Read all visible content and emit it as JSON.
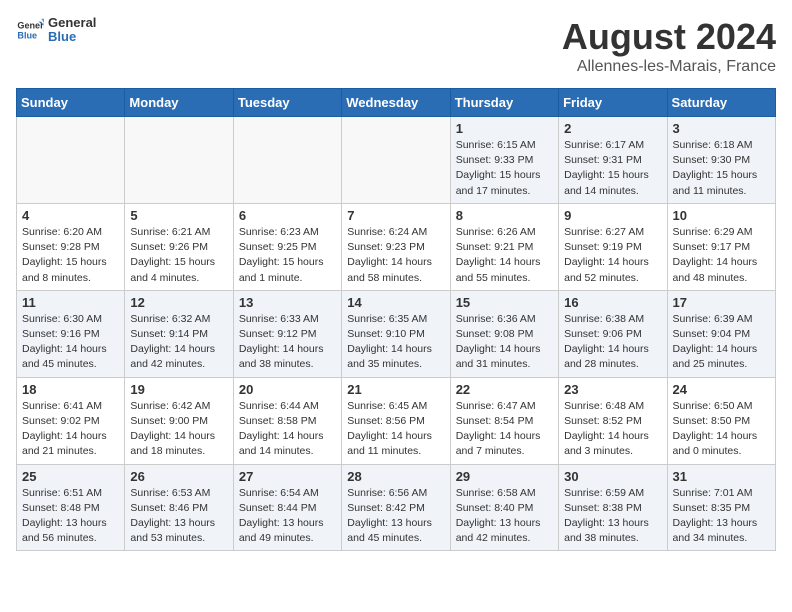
{
  "header": {
    "logo_general": "General",
    "logo_blue": "Blue",
    "month_year": "August 2024",
    "location": "Allennes-les-Marais, France"
  },
  "days_of_week": [
    "Sunday",
    "Monday",
    "Tuesday",
    "Wednesday",
    "Thursday",
    "Friday",
    "Saturday"
  ],
  "weeks": [
    [
      {
        "day": "",
        "info": ""
      },
      {
        "day": "",
        "info": ""
      },
      {
        "day": "",
        "info": ""
      },
      {
        "day": "",
        "info": ""
      },
      {
        "day": "1",
        "info": "Sunrise: 6:15 AM\nSunset: 9:33 PM\nDaylight: 15 hours\nand 17 minutes."
      },
      {
        "day": "2",
        "info": "Sunrise: 6:17 AM\nSunset: 9:31 PM\nDaylight: 15 hours\nand 14 minutes."
      },
      {
        "day": "3",
        "info": "Sunrise: 6:18 AM\nSunset: 9:30 PM\nDaylight: 15 hours\nand 11 minutes."
      }
    ],
    [
      {
        "day": "4",
        "info": "Sunrise: 6:20 AM\nSunset: 9:28 PM\nDaylight: 15 hours\nand 8 minutes."
      },
      {
        "day": "5",
        "info": "Sunrise: 6:21 AM\nSunset: 9:26 PM\nDaylight: 15 hours\nand 4 minutes."
      },
      {
        "day": "6",
        "info": "Sunrise: 6:23 AM\nSunset: 9:25 PM\nDaylight: 15 hours\nand 1 minute."
      },
      {
        "day": "7",
        "info": "Sunrise: 6:24 AM\nSunset: 9:23 PM\nDaylight: 14 hours\nand 58 minutes."
      },
      {
        "day": "8",
        "info": "Sunrise: 6:26 AM\nSunset: 9:21 PM\nDaylight: 14 hours\nand 55 minutes."
      },
      {
        "day": "9",
        "info": "Sunrise: 6:27 AM\nSunset: 9:19 PM\nDaylight: 14 hours\nand 52 minutes."
      },
      {
        "day": "10",
        "info": "Sunrise: 6:29 AM\nSunset: 9:17 PM\nDaylight: 14 hours\nand 48 minutes."
      }
    ],
    [
      {
        "day": "11",
        "info": "Sunrise: 6:30 AM\nSunset: 9:16 PM\nDaylight: 14 hours\nand 45 minutes."
      },
      {
        "day": "12",
        "info": "Sunrise: 6:32 AM\nSunset: 9:14 PM\nDaylight: 14 hours\nand 42 minutes."
      },
      {
        "day": "13",
        "info": "Sunrise: 6:33 AM\nSunset: 9:12 PM\nDaylight: 14 hours\nand 38 minutes."
      },
      {
        "day": "14",
        "info": "Sunrise: 6:35 AM\nSunset: 9:10 PM\nDaylight: 14 hours\nand 35 minutes."
      },
      {
        "day": "15",
        "info": "Sunrise: 6:36 AM\nSunset: 9:08 PM\nDaylight: 14 hours\nand 31 minutes."
      },
      {
        "day": "16",
        "info": "Sunrise: 6:38 AM\nSunset: 9:06 PM\nDaylight: 14 hours\nand 28 minutes."
      },
      {
        "day": "17",
        "info": "Sunrise: 6:39 AM\nSunset: 9:04 PM\nDaylight: 14 hours\nand 25 minutes."
      }
    ],
    [
      {
        "day": "18",
        "info": "Sunrise: 6:41 AM\nSunset: 9:02 PM\nDaylight: 14 hours\nand 21 minutes."
      },
      {
        "day": "19",
        "info": "Sunrise: 6:42 AM\nSunset: 9:00 PM\nDaylight: 14 hours\nand 18 minutes."
      },
      {
        "day": "20",
        "info": "Sunrise: 6:44 AM\nSunset: 8:58 PM\nDaylight: 14 hours\nand 14 minutes."
      },
      {
        "day": "21",
        "info": "Sunrise: 6:45 AM\nSunset: 8:56 PM\nDaylight: 14 hours\nand 11 minutes."
      },
      {
        "day": "22",
        "info": "Sunrise: 6:47 AM\nSunset: 8:54 PM\nDaylight: 14 hours\nand 7 minutes."
      },
      {
        "day": "23",
        "info": "Sunrise: 6:48 AM\nSunset: 8:52 PM\nDaylight: 14 hours\nand 3 minutes."
      },
      {
        "day": "24",
        "info": "Sunrise: 6:50 AM\nSunset: 8:50 PM\nDaylight: 14 hours\nand 0 minutes."
      }
    ],
    [
      {
        "day": "25",
        "info": "Sunrise: 6:51 AM\nSunset: 8:48 PM\nDaylight: 13 hours\nand 56 minutes."
      },
      {
        "day": "26",
        "info": "Sunrise: 6:53 AM\nSunset: 8:46 PM\nDaylight: 13 hours\nand 53 minutes."
      },
      {
        "day": "27",
        "info": "Sunrise: 6:54 AM\nSunset: 8:44 PM\nDaylight: 13 hours\nand 49 minutes."
      },
      {
        "day": "28",
        "info": "Sunrise: 6:56 AM\nSunset: 8:42 PM\nDaylight: 13 hours\nand 45 minutes."
      },
      {
        "day": "29",
        "info": "Sunrise: 6:58 AM\nSunset: 8:40 PM\nDaylight: 13 hours\nand 42 minutes."
      },
      {
        "day": "30",
        "info": "Sunrise: 6:59 AM\nSunset: 8:38 PM\nDaylight: 13 hours\nand 38 minutes."
      },
      {
        "day": "31",
        "info": "Sunrise: 7:01 AM\nSunset: 8:35 PM\nDaylight: 13 hours\nand 34 minutes."
      }
    ]
  ]
}
